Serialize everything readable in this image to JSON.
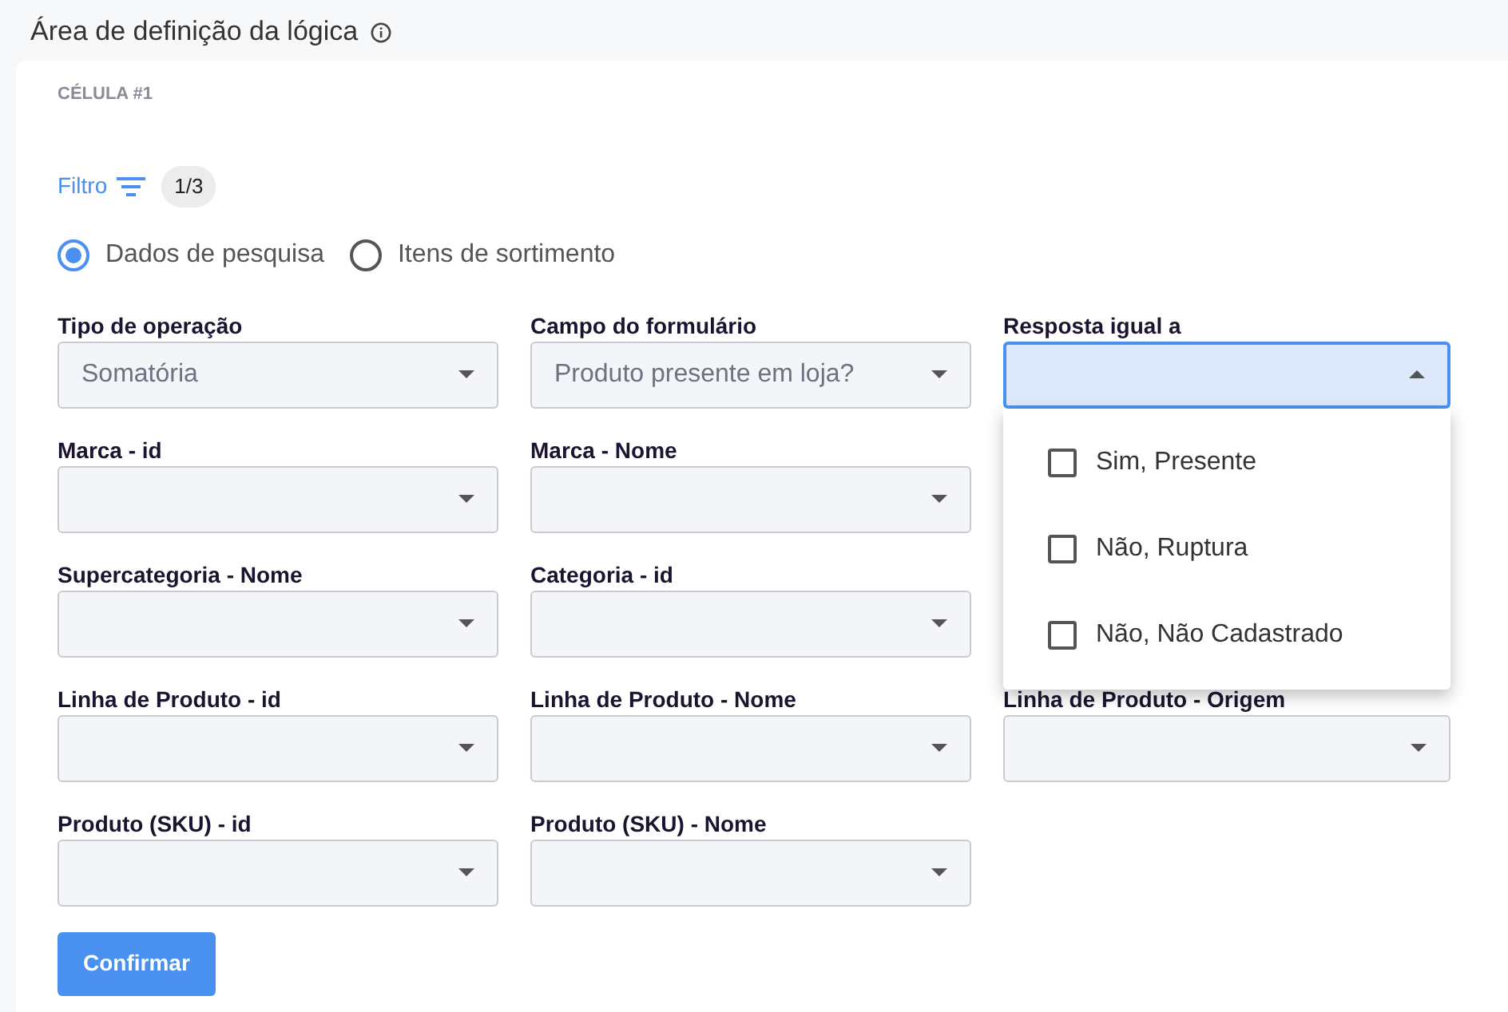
{
  "header": {
    "title": "Área de definição da lógica"
  },
  "cell": {
    "title": "CÉLULA #1"
  },
  "filter": {
    "label": "Filtro",
    "count": "1/3"
  },
  "source_options": [
    {
      "label": "Dados de pesquisa",
      "selected": true
    },
    {
      "label": "Itens de sortimento",
      "selected": false
    }
  ],
  "rows": [
    [
      {
        "label": "Tipo de operação",
        "value": "Somatória",
        "open": false
      },
      {
        "label": "Campo do formulário",
        "value": "Produto presente em loja?",
        "open": false
      },
      {
        "label": "Resposta igual a",
        "open": true,
        "options": [
          {
            "label": "Sim, Presente",
            "checked": false
          },
          {
            "label": "Não, Ruptura",
            "checked": false
          },
          {
            "label": "Não, Não Cadastrado",
            "checked": false
          }
        ]
      }
    ],
    [
      {
        "label": "Marca - id",
        "open": false
      },
      {
        "label": "Marca - Nome",
        "open": false
      }
    ],
    [
      {
        "label": "Supercategoria - Nome",
        "open": false
      },
      {
        "label": "Categoria - id",
        "open": false
      }
    ],
    [
      {
        "label": "Linha de Produto - id",
        "open": false
      },
      {
        "label": "Linha de Produto - Nome",
        "open": false
      },
      {
        "label": "Linha de Produto - Origem",
        "open": false
      }
    ],
    [
      {
        "label": "Produto (SKU) - id",
        "open": false
      },
      {
        "label": "Produto (SKU) - Nome",
        "open": false
      }
    ]
  ],
  "confirm_button": "Confirmar"
}
